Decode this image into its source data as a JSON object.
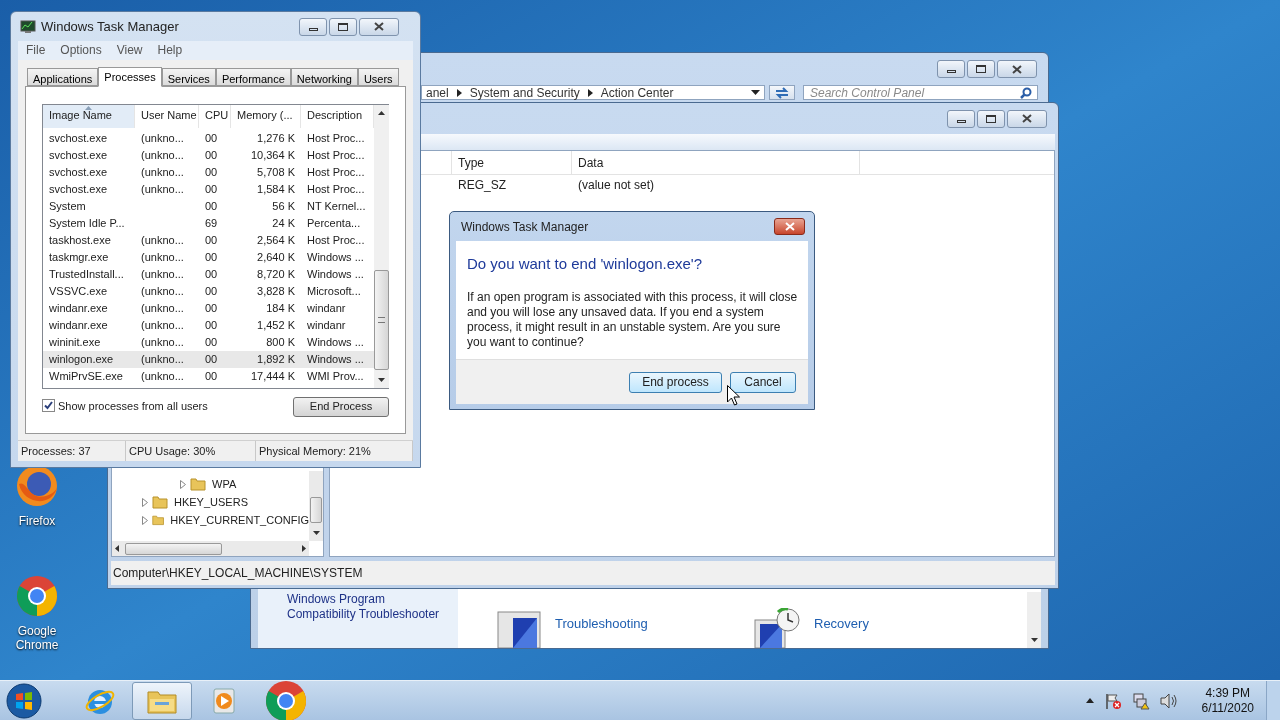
{
  "desktop_icons": [
    {
      "label": "Firefox",
      "kind": "firefox"
    },
    {
      "label": "Google Chrome",
      "kind": "chrome"
    }
  ],
  "control_panel": {
    "breadcrumb": [
      "anel",
      "System and Security",
      "Action Center"
    ],
    "search": {
      "placeholder": "Search Control Panel"
    },
    "sidebar_link": "Windows Program Compatibility Troubleshooter",
    "items": [
      {
        "label": "Troubleshooting",
        "kind": "troubleshooting"
      },
      {
        "label": "Recovery",
        "kind": "recovery"
      }
    ]
  },
  "registry_editor": {
    "tree": [
      {
        "children": [
          {
            "label": "WPA",
            "expanded": false
          }
        ]
      },
      {
        "label": "HKEY_USERS",
        "expanded": false
      },
      {
        "label": "HKEY_CURRENT_CONFIG",
        "expanded": false
      }
    ],
    "columns": [
      "Type",
      "Data"
    ],
    "rows": [
      {
        "type": "REG_SZ",
        "data": "(value not set)"
      }
    ],
    "status_bar": "Computer\\HKEY_LOCAL_MACHINE\\SYSTEM"
  },
  "task_manager": {
    "title": "Windows Task Manager",
    "menu": [
      "File",
      "Options",
      "View",
      "Help"
    ],
    "tabs": [
      {
        "label": "Applications",
        "selected": false
      },
      {
        "label": "Processes",
        "selected": true
      },
      {
        "label": "Services",
        "selected": false
      },
      {
        "label": "Performance",
        "selected": false
      },
      {
        "label": "Networking",
        "selected": false
      },
      {
        "label": "Users",
        "selected": false
      }
    ],
    "columns": [
      {
        "label": "Image Name",
        "sorted": true
      },
      {
        "label": "User Name",
        "sorted": false
      },
      {
        "label": "CPU",
        "sorted": false
      },
      {
        "label": "Memory (...",
        "sorted": false
      },
      {
        "label": "Description",
        "sorted": false
      }
    ],
    "rows": [
      {
        "cells": [
          "svchost.exe",
          "(unkno...",
          "00",
          "1,276 K",
          "Host Proc..."
        ],
        "selected": false
      },
      {
        "cells": [
          "svchost.exe",
          "(unkno...",
          "00",
          "10,364 K",
          "Host Proc..."
        ],
        "selected": false
      },
      {
        "cells": [
          "svchost.exe",
          "(unkno...",
          "00",
          "5,708 K",
          "Host Proc..."
        ],
        "selected": false
      },
      {
        "cells": [
          "svchost.exe",
          "(unkno...",
          "00",
          "1,584 K",
          "Host Proc..."
        ],
        "selected": false
      },
      {
        "cells": [
          "System",
          "",
          "00",
          "56 K",
          "NT Kernel..."
        ],
        "selected": false
      },
      {
        "cells": [
          "System Idle P...",
          "",
          "69",
          "24 K",
          "Percenta..."
        ],
        "selected": false
      },
      {
        "cells": [
          "taskhost.exe",
          "(unkno...",
          "00",
          "2,564 K",
          "Host Proc..."
        ],
        "selected": false
      },
      {
        "cells": [
          "taskmgr.exe",
          "(unkno...",
          "00",
          "2,640 K",
          "Windows ..."
        ],
        "selected": false
      },
      {
        "cells": [
          "TrustedInstall...",
          "(unkno...",
          "00",
          "8,720 K",
          "Windows ..."
        ],
        "selected": false
      },
      {
        "cells": [
          "VSSVC.exe",
          "(unkno...",
          "00",
          "3,828 K",
          "Microsoft..."
        ],
        "selected": false
      },
      {
        "cells": [
          "windanr.exe",
          "(unkno...",
          "00",
          "184 K",
          "windanr"
        ],
        "selected": false
      },
      {
        "cells": [
          "windanr.exe",
          "(unkno...",
          "00",
          "1,452 K",
          "windanr"
        ],
        "selected": false
      },
      {
        "cells": [
          "wininit.exe",
          "(unkno...",
          "00",
          "800 K",
          "Windows ..."
        ],
        "selected": false
      },
      {
        "cells": [
          "winlogon.exe",
          "(unkno...",
          "00",
          "1,892 K",
          "Windows ..."
        ],
        "selected": true
      },
      {
        "cells": [
          "WmiPrvSE.exe",
          "(unkno...",
          "00",
          "17,444 K",
          "WMI Prov..."
        ],
        "selected": false
      }
    ],
    "show_all_users": {
      "label": "Show processes from all users",
      "checked": true
    },
    "end_button": "End Process",
    "status_bar": [
      "Processes: 37",
      "CPU Usage: 30%",
      "Physical Memory: 21%"
    ]
  },
  "dialog": {
    "title": "Windows Task Manager",
    "heading": "Do you want to end 'winlogon.exe'?",
    "message": "If an open program is associated with this process, it will close and you will lose any unsaved data. If you end a system process, it might result in an unstable system. Are you sure you want to continue?",
    "buttons": [
      "End process",
      "Cancel"
    ]
  },
  "taskbar": {
    "items": [
      {
        "kind": "ie",
        "active": false
      },
      {
        "kind": "explorer",
        "active": true
      },
      {
        "kind": "media",
        "active": false
      },
      {
        "kind": "chrome",
        "active": false
      }
    ],
    "time": "4:39 PM",
    "date": "6/11/2020"
  }
}
